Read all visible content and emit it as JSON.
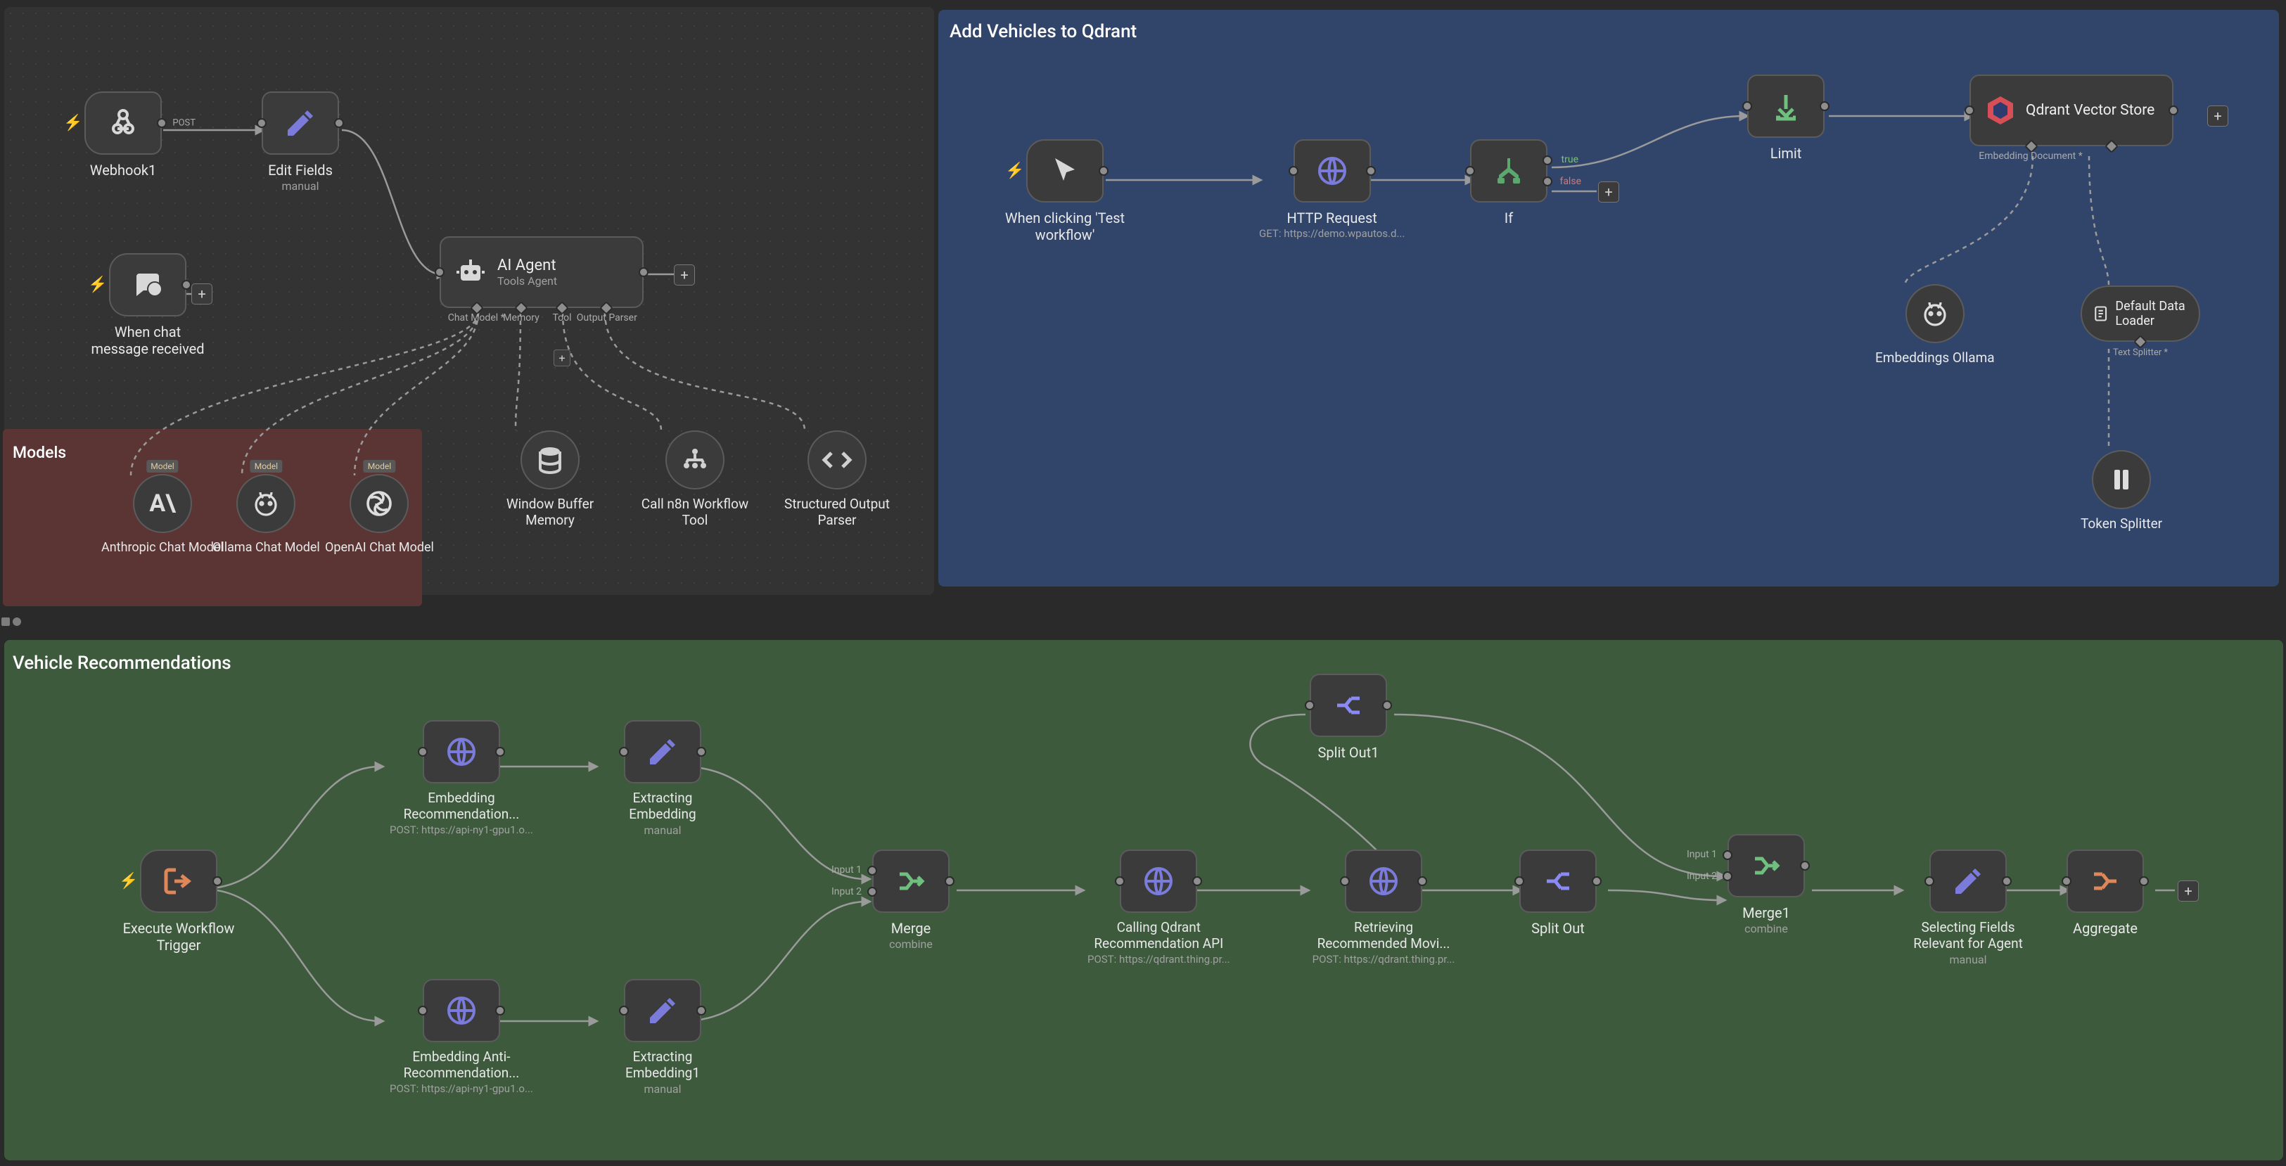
{
  "sections": {
    "qdrant": {
      "title": "Add Vehicles to Qdrant"
    },
    "vehicle_rec": {
      "title": "Vehicle Recommendations"
    },
    "models": {
      "title": "Models"
    }
  },
  "nodes": {
    "webhook1": {
      "label": "Webhook1",
      "port_tag": "POST"
    },
    "edit_fields": {
      "label": "Edit Fields",
      "sub": "manual"
    },
    "chat_msg": {
      "label": "When chat message received"
    },
    "ai_agent": {
      "label": "AI Agent",
      "sub": "Tools Agent",
      "bottom_ports": [
        "Chat Model *",
        "Memory",
        "Tool",
        "Output Parser"
      ]
    },
    "anthropic": {
      "label": "Anthropic Chat Model",
      "badge": "Model"
    },
    "ollama_cm": {
      "label": "Ollama Chat Model",
      "badge": "Model"
    },
    "openai_cm": {
      "label": "OpenAI Chat Model",
      "badge": "Model"
    },
    "window_buf": {
      "label": "Window Buffer Memory"
    },
    "call_n8n": {
      "label": "Call n8n Workflow Tool"
    },
    "struct_parser": {
      "label": "Structured Output Parser"
    },
    "test_click": {
      "label": "When clicking 'Test workflow'"
    },
    "http_req": {
      "label": "HTTP Request",
      "sub": "GET: https://demo.wpautos.d..."
    },
    "if_node": {
      "label": "If",
      "true": "true",
      "false": "false"
    },
    "limit": {
      "label": "Limit"
    },
    "qdrant_vs": {
      "label": "Qdrant Vector Store",
      "bottom_port": "Embedding Document *"
    },
    "emb_ollama": {
      "label": "Embeddings Ollama"
    },
    "data_loader": {
      "label": "Default Data Loader",
      "bottom_port": "Text Splitter *"
    },
    "token_split": {
      "label": "Token Splitter"
    },
    "exec_trigger": {
      "label": "Execute Workflow Trigger"
    },
    "emb_rec": {
      "label": "Embedding Recommendation...",
      "sub": "POST: https://api-ny1-gpu1.o..."
    },
    "extract_emb": {
      "label": "Extracting Embedding",
      "sub": "manual"
    },
    "emb_anti": {
      "label": "Embedding Anti-Recommendation...",
      "sub": "POST: https://api-ny1-gpu1.o..."
    },
    "extract_emb1": {
      "label": "Extracting Embedding1",
      "sub": "manual"
    },
    "merge": {
      "label": "Merge",
      "sub": "combine",
      "in1": "Input 1",
      "in2": "Input 2"
    },
    "call_qdrant": {
      "label": "Calling Qdrant Recommendation API",
      "sub": "POST: https://qdrant.thing.pr..."
    },
    "retrieve_mov": {
      "label": "Retrieving Recommended Movi...",
      "sub": "POST: https://qdrant.thing.pr..."
    },
    "split_out": {
      "label": "Split Out"
    },
    "split_out1": {
      "label": "Split Out1"
    },
    "merge1": {
      "label": "Merge1",
      "sub": "combine",
      "in1": "Input 1",
      "in2": "Input 2"
    },
    "sel_fields": {
      "label": "Selecting Fields Relevant for Agent",
      "sub": "manual"
    },
    "aggregate": {
      "label": "Aggregate"
    }
  }
}
